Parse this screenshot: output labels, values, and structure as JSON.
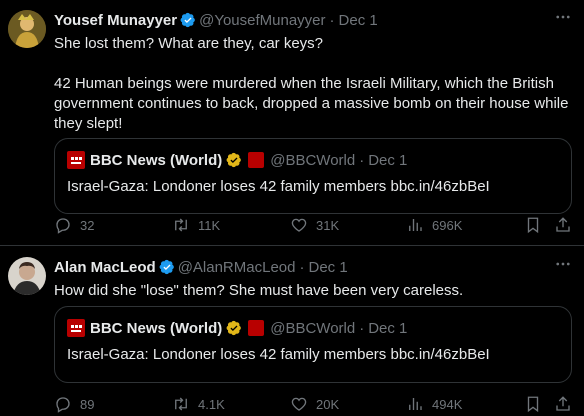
{
  "tweets": [
    {
      "author_name": "Yousef Munayyer",
      "handle": "@YousefMunayyer",
      "separator": "·",
      "date": "Dec 1",
      "text": "She lost them? What are they, car keys?\n\n42 Human beings were murdered when the Israeli Military, which the British government continues to back, dropped a massive bomb on their house while they slept!",
      "quote": {
        "author_name": "BBC News (World)",
        "handle": "@BBCWorld",
        "separator": "·",
        "date": "Dec 1",
        "text": "Israel-Gaza: Londoner loses 42 family members bbc.in/46zbBeI"
      },
      "replies": "32",
      "retweets": "11K",
      "likes": "31K",
      "views": "696K"
    },
    {
      "author_name": "Alan MacLeod",
      "handle": "@AlanRMacLeod",
      "separator": "·",
      "date": "Dec 1",
      "text": "How did she \"lose\" them? She must have been very careless.",
      "quote": {
        "author_name": "BBC News (World)",
        "handle": "@BBCWorld",
        "separator": "·",
        "date": "Dec 1",
        "text": "Israel-Gaza: Londoner loses 42 family members bbc.in/46zbBeI"
      },
      "replies": "89",
      "retweets": "4.1K",
      "likes": "20K",
      "views": "494K"
    }
  ],
  "icons": {
    "verified": "verified-blue-icon",
    "verified_gold": "verified-gold-icon",
    "reply": "reply-icon",
    "retweet": "retweet-icon",
    "like": "heart-icon",
    "views": "views-icon",
    "bookmark": "bookmark-icon",
    "share": "share-icon",
    "more": "more-icon"
  },
  "colors": {
    "background": "#000000",
    "text": "#e7e9ea",
    "muted": "#71767b",
    "border": "#2f3336",
    "verified_blue": "#1d9bf0",
    "verified_gold": "#e2b719",
    "bbc_red": "#b80000"
  }
}
